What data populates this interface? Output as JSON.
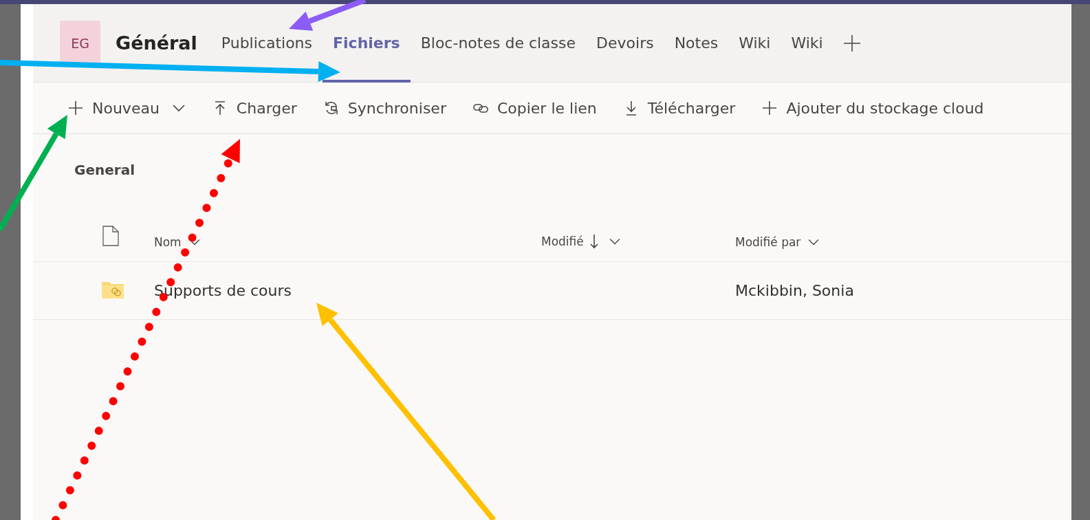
{
  "team": {
    "avatar": "EG",
    "name": "Général"
  },
  "tabs": [
    {
      "label": "Publications",
      "selected": false
    },
    {
      "label": "Fichiers",
      "selected": true
    },
    {
      "label": "Bloc-notes de classe",
      "selected": false
    },
    {
      "label": "Devoirs",
      "selected": false
    },
    {
      "label": "Notes",
      "selected": false
    },
    {
      "label": "Wiki",
      "selected": false
    },
    {
      "label": "Wiki",
      "selected": false
    }
  ],
  "toolbar": [
    {
      "label": "Nouveau",
      "kind": "new"
    },
    {
      "label": "Charger",
      "kind": "upload"
    },
    {
      "label": "Synchroniser",
      "kind": "sync"
    },
    {
      "label": "Copier le lien",
      "kind": "link"
    },
    {
      "label": "Télécharger",
      "kind": "download"
    },
    {
      "label": "Ajouter du stockage cloud",
      "kind": "add"
    }
  ],
  "folder_title": "General",
  "table": {
    "columns": [
      {
        "label": "Nom",
        "sorted": false
      },
      {
        "label": "Modifié",
        "sorted": true
      },
      {
        "label": "Modifié par",
        "sorted": false
      }
    ],
    "rows": [
      {
        "kind": "folder",
        "name": "Supports de cours",
        "modified_by": "Mckibbin, Sonia"
      }
    ]
  },
  "annotations": [
    {
      "kind": "solid",
      "color": "#8b5cf6"
    },
    {
      "kind": "solid",
      "color": "#00b0f0"
    },
    {
      "kind": "solid",
      "color": "#00b050"
    },
    {
      "kind": "dotted",
      "color": "#ff0000"
    },
    {
      "kind": "solid",
      "color": "#ffc000"
    }
  ]
}
